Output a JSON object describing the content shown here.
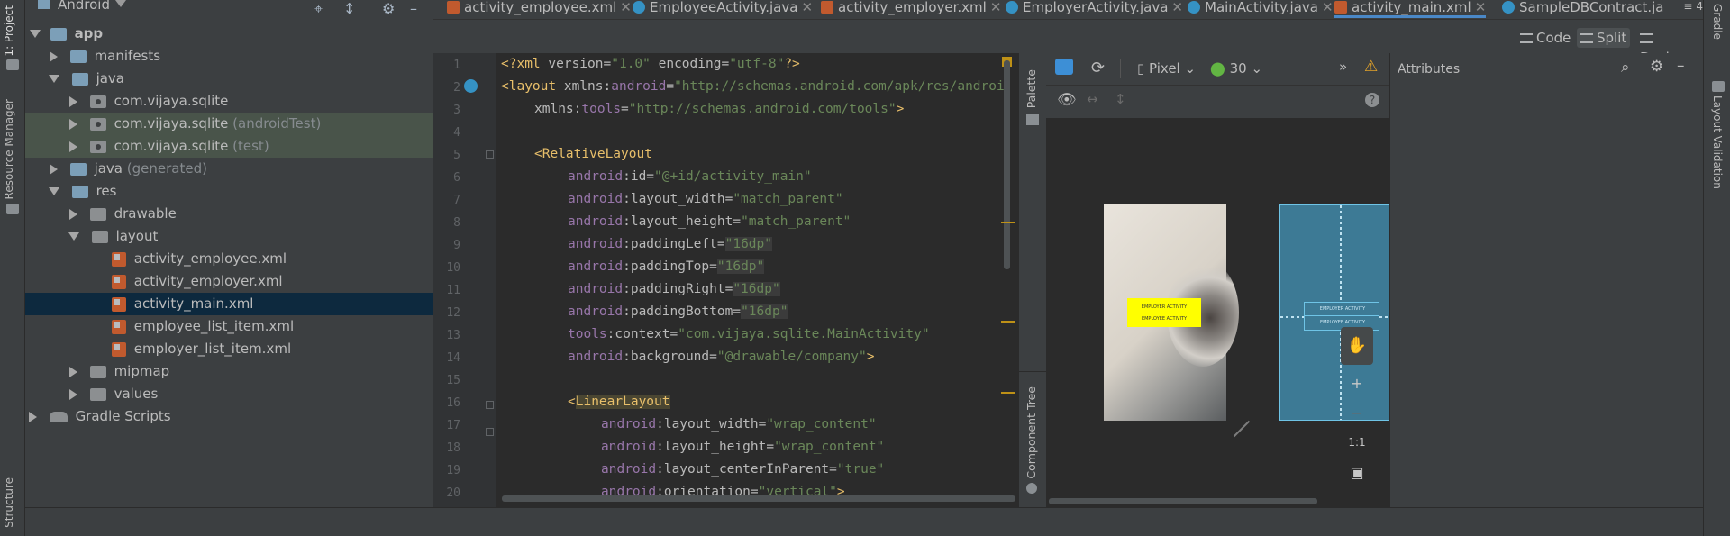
{
  "left_strip": {
    "project_tab": "1: Project",
    "resource_manager_tab": "Resource Manager",
    "structure_tab": "Structure"
  },
  "right_strip": {
    "gradle_tab": "Gradle",
    "layout_validation_tab": "Layout Validation"
  },
  "project_panel": {
    "view_selector": "Android",
    "tree": [
      {
        "label": "app",
        "suffix": ""
      },
      {
        "label": "manifests",
        "suffix": ""
      },
      {
        "label": "java",
        "suffix": ""
      },
      {
        "label": "com.vijaya.sqlite",
        "suffix": ""
      },
      {
        "label": "com.vijaya.sqlite",
        "suffix": " (androidTest)"
      },
      {
        "label": "com.vijaya.sqlite",
        "suffix": " (test)"
      },
      {
        "label": "java",
        "suffix": " (generated)"
      },
      {
        "label": "res",
        "suffix": ""
      },
      {
        "label": "drawable",
        "suffix": ""
      },
      {
        "label": "layout",
        "suffix": ""
      },
      {
        "label": "activity_employee.xml",
        "suffix": ""
      },
      {
        "label": "activity_employer.xml",
        "suffix": ""
      },
      {
        "label": "activity_main.xml",
        "suffix": ""
      },
      {
        "label": "employee_list_item.xml",
        "suffix": ""
      },
      {
        "label": "employer_list_item.xml",
        "suffix": ""
      },
      {
        "label": "mipmap",
        "suffix": ""
      },
      {
        "label": "values",
        "suffix": ""
      },
      {
        "label": "Gradle Scripts",
        "suffix": ""
      }
    ]
  },
  "tabs": [
    {
      "label": "activity_employee.xml"
    },
    {
      "label": "EmployeeActivity.java"
    },
    {
      "label": "activity_employer.xml"
    },
    {
      "label": "EmployerActivity.java"
    },
    {
      "label": "MainActivity.java"
    },
    {
      "label": "activity_main.xml"
    },
    {
      "label": "SampleDBContract.ja"
    }
  ],
  "tab_overflow": "≡ 4",
  "view_modes": {
    "code": "Code",
    "split": "Split",
    "design": "Design",
    "active": "Split"
  },
  "editor": {
    "lines": [
      {
        "n": "1"
      },
      {
        "n": "2"
      },
      {
        "n": "3"
      },
      {
        "n": "4"
      },
      {
        "n": "5"
      },
      {
        "n": "6"
      },
      {
        "n": "7"
      },
      {
        "n": "8"
      },
      {
        "n": "9"
      },
      {
        "n": "10"
      },
      {
        "n": "11"
      },
      {
        "n": "12"
      },
      {
        "n": "13"
      },
      {
        "n": "14"
      },
      {
        "n": "15"
      },
      {
        "n": "16"
      },
      {
        "n": "17"
      },
      {
        "n": "18"
      },
      {
        "n": "19"
      },
      {
        "n": "20"
      }
    ],
    "code": {
      "l1a": "<?xml ",
      "l1b": "version",
      "l1c": "=",
      "l1d": "\"1.0\"",
      "l1e": " encoding",
      "l1f": "=",
      "l1g": "\"utf-8\"",
      "l1h": "?>",
      "l2a": "<layout ",
      "l2b": "xmlns:",
      "l2c": "android",
      "l2d": "=",
      "l2e": "\"http://schemas.android.com/apk/res/androi",
      "l3a": "xmlns:",
      "l3b": "tools",
      "l3c": "=",
      "l3d": "\"http://schemas.android.com/tools\"",
      "l3e": ">",
      "l5a": "<",
      "l5b": "RelativeLayout",
      "attr_android": "android",
      "l6a": ":id=",
      "l6b": "\"@+id/activity_main\"",
      "l7a": ":layout_width=",
      "l7b": "\"match_parent\"",
      "l8a": ":layout_height=",
      "l8b": "\"match_parent\"",
      "l9a": ":paddingLeft=",
      "l9b": "\"16dp\"",
      "l10a": ":paddingTop=",
      "l10b": "\"16dp\"",
      "l11a": ":paddingRight=",
      "l11b": "\"16dp\"",
      "l12a": ":paddingBottom=",
      "l12b": "\"16dp\"",
      "l13a": "tools",
      "l13b": ":context=",
      "l13c": "\"com.vijaya.sqlite.MainActivity\"",
      "l14a": ":background=",
      "l14b": "\"@drawable/company\"",
      "l14c": ">",
      "l16a": "<",
      "l16b": "LinearLayout",
      "l17a": ":layout_width=",
      "l17b": "\"wrap_content\"",
      "l18a": ":layout_height=",
      "l18b": "\"wrap_content\"",
      "l19a": ":layout_centerInParent=",
      "l19b": "\"true\"",
      "l20a": ":orientation=",
      "l20b": "\"vertical\"",
      "l20c": ">"
    }
  },
  "palette_strip": {
    "palette_tab": "Palette",
    "component_tree_tab": "Component Tree"
  },
  "design": {
    "device": "Pixel",
    "api": "30",
    "preview_buttons": [
      "EMPLOYER ACTIVITY",
      "EMPLOYEE ACTIVITY"
    ],
    "zoom_reset": "1:1"
  },
  "attributes": {
    "title": "Attributes"
  },
  "colors": {
    "accent": "#4a88c7",
    "selection": "#0d293e",
    "blueprint": "#3d7a95",
    "preview_button": "#ffff00"
  }
}
